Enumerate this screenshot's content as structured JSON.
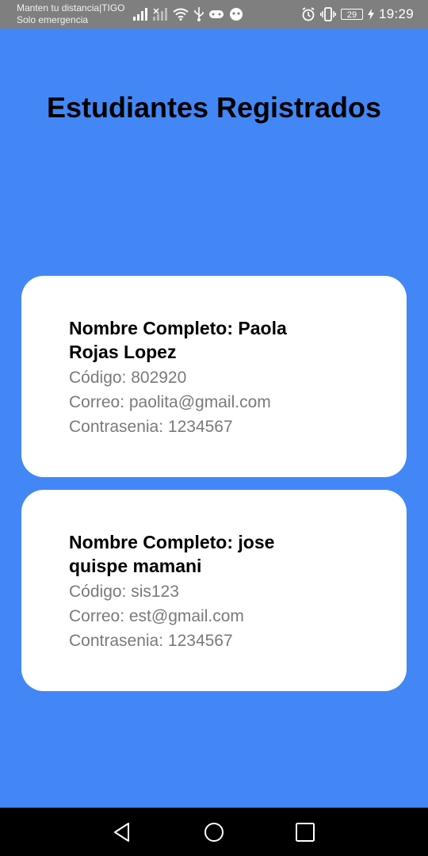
{
  "status_bar": {
    "carrier_line1": "Manten tu distancia|TIGO",
    "carrier_line2": "Solo emergencia",
    "battery": "29",
    "time": "19:29"
  },
  "page": {
    "title": "Estudiantes Registrados"
  },
  "students": [
    {
      "name": "Nombre Completo: Paola Rojas Lopez",
      "code": "Código: 802920",
      "email": "Correo: paolita@gmail.com",
      "password": "Contrasenia: 1234567"
    },
    {
      "name": "Nombre Completo: jose quispe mamani",
      "code": "Código: sis123",
      "email": "Correo: est@gmail.com",
      "password": "Contrasenia: 1234567"
    }
  ],
  "colors": {
    "background": "#4287f5",
    "card": "#ffffff",
    "status_bar": "#7f7f7f",
    "nav_bar": "#000000"
  }
}
